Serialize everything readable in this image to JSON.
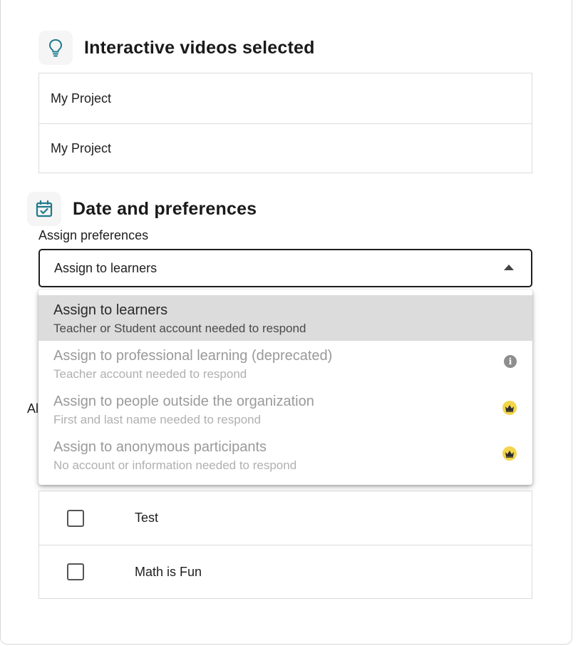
{
  "sections": {
    "videos_title": "Interactive videos selected",
    "date_title": "Date and preferences"
  },
  "videos": [
    {
      "name": "My Project"
    },
    {
      "name": "My Project"
    }
  ],
  "assign": {
    "label": "Assign preferences",
    "selected": "Assign to learners",
    "options": [
      {
        "title": "Assign to learners",
        "subtitle": "Teacher or Student account needed to respond",
        "icon": null
      },
      {
        "title": "Assign to professional learning (deprecated)",
        "subtitle": "Teacher account needed to respond",
        "icon": "info-icon"
      },
      {
        "title": "Assign to people outside the organization",
        "subtitle": "First and last name needed to respond",
        "icon": "crown-icon"
      },
      {
        "title": "Assign to anonymous participants",
        "subtitle": "No account or information needed to respond",
        "icon": "crown-icon"
      }
    ]
  },
  "obscured_label": "Al",
  "classes": [
    {
      "name": "Test",
      "checked": false
    },
    {
      "name": "Math is Fun",
      "checked": false
    }
  ],
  "colors": {
    "accent": "#1f7a8c",
    "crown": "#f2d54a",
    "selected_bg": "#dcdcdc"
  }
}
